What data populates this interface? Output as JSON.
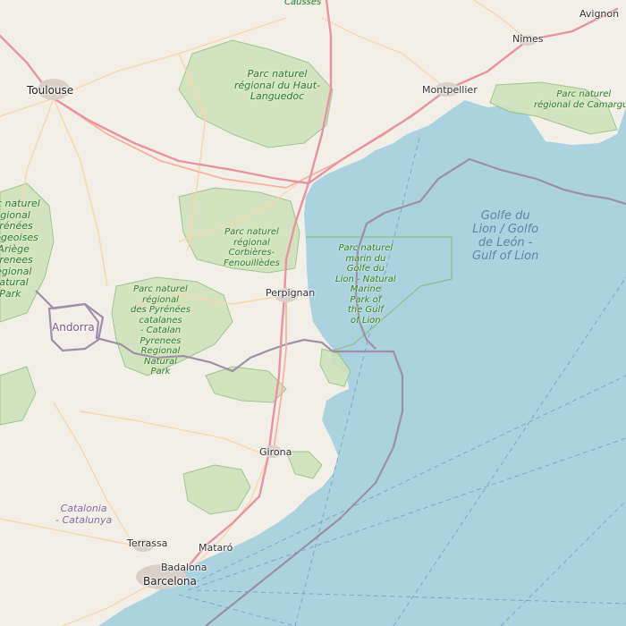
{
  "map": {
    "colors": {
      "sea": "#aad3df",
      "land": "#f2efe9",
      "park_fill": "#cfe2b8",
      "park_border": "#8fbf7a",
      "motorway": "#e892a2",
      "trunk": "#f9b29c",
      "primary": "#fcd6a4",
      "border": "#9e8fa8",
      "ferry": "#7f9bcf"
    },
    "cities": [
      {
        "name": "Toulouse",
        "size": "big"
      },
      {
        "name": "Montpellier",
        "size": "normal"
      },
      {
        "name": "Nîmes",
        "size": "normal"
      },
      {
        "name": "Avignon",
        "size": "normal"
      },
      {
        "name": "Perpignan",
        "size": "normal"
      },
      {
        "name": "Girona",
        "size": "normal"
      },
      {
        "name": "Terrassa",
        "size": "normal"
      },
      {
        "name": "Mataró",
        "size": "normal"
      },
      {
        "name": "Badalona",
        "size": "normal"
      },
      {
        "name": "Barcelona",
        "size": "big"
      },
      {
        "name": "Causses",
        "size": "park"
      }
    ],
    "parks": [
      {
        "lines": [
          "Parc naturel",
          "régional du Haut-",
          "Languedoc"
        ]
      },
      {
        "lines": [
          "Parc naturel",
          "régional de Camargue"
        ]
      },
      {
        "lines": [
          "Parc naturel",
          "régional",
          "Corbières-",
          "Fenouillèdes"
        ]
      },
      {
        "lines": [
          "Parc naturel",
          "régional",
          "des Pyrénées",
          "catalanes",
          "- Catalan",
          "Pyrenees",
          "Regional",
          "Natural",
          "Park"
        ]
      },
      {
        "lines": [
          "Parc naturel",
          "régional",
          "Pyrénées",
          "ariégeoises",
          "- Ariège",
          "Pyrenees",
          "Regional",
          "Natural",
          "Park"
        ]
      },
      {
        "lines": [
          "Parc naturel",
          "marin du",
          "Golfe du",
          "Lion - Natural",
          "Marine",
          "Park of",
          "the Gulf",
          "of Lion"
        ]
      }
    ],
    "sea_label": {
      "lines": [
        "Golfe du",
        "Lion / Golfo",
        "de León -",
        "Gulf of Lion"
      ]
    },
    "country_labels": [
      "Andorra"
    ],
    "region_labels": [
      {
        "lines": [
          "Catalonia",
          "- Catalunya"
        ]
      }
    ]
  }
}
